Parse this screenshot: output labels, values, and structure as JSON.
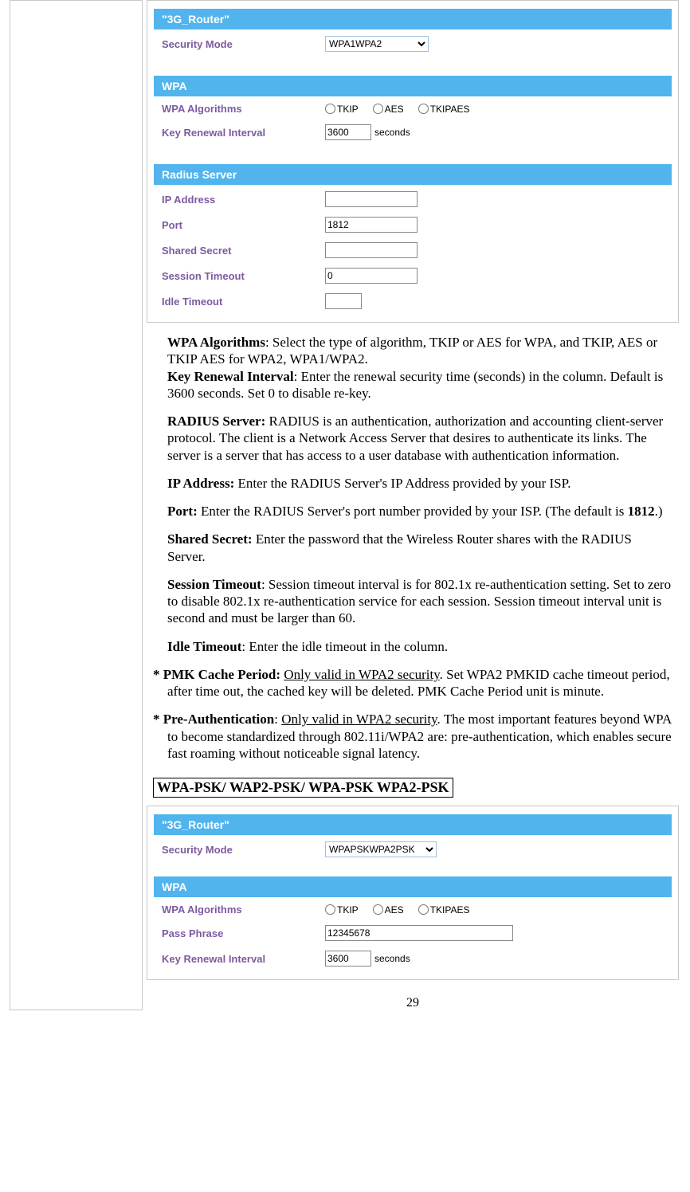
{
  "panel1": {
    "title": "\"3G_Router\"",
    "security_mode_label": "Security Mode",
    "security_mode_value": "WPA1WPA2",
    "wpa_header": "WPA",
    "wpa_algorithms_label": "WPA Algorithms",
    "algo_tkip": "TKIP",
    "algo_aes": "AES",
    "algo_tkipaes": "TKIPAES",
    "key_renewal_label": "Key Renewal Interval",
    "key_renewal_value": "3600",
    "seconds": "seconds",
    "radius_header": "Radius Server",
    "ip_label": "IP Address",
    "ip_value": "",
    "port_label": "Port",
    "port_value": "1812",
    "shared_secret_label": "Shared Secret",
    "shared_secret_value": "",
    "session_timeout_label": "Session Timeout",
    "session_timeout_value": "0",
    "idle_timeout_label": "Idle Timeout",
    "idle_timeout_value": ""
  },
  "desc": {
    "wpa_alg_bold": "WPA Algorithms",
    "wpa_alg_text": ": Select the type of algorithm, TKIP or AES for WPA, and TKIP, AES or TKIP AES for WPA2, WPA1/WPA2.",
    "key_renewal_bold": "Key Renewal Interval",
    "key_renewal_text": ": Enter the renewal security time (seconds) in the column. Default is 3600 seconds. Set 0 to disable re-key.",
    "radius_bold": "RADIUS Server:",
    "radius_text": " RADIUS is an authentication, authorization and accounting client-server protocol. The client is a Network Access Server that desires to authenticate its links. The server is a server that has access to a user database with authentication information.",
    "ip_bold": "IP Address:",
    "ip_text": " Enter the RADIUS Server's IP Address provided by your ISP.",
    "port_bold": "Port:",
    "port_text1": " Enter the RADIUS Server's port number provided by your ISP. (The default is ",
    "port_1812": "1812",
    "port_text2": ".)",
    "shared_bold": "Shared Secret:",
    "shared_text": " Enter the password that the Wireless  Router shares with the RADIUS Server.",
    "session_bold": "Session Timeout",
    "session_text": ": Session timeout interval is for 802.1x re-authentication setting. Set to zero to disable 802.1x re-authentication service for each session. Session timeout interval unit is second and must be larger than 60.",
    "idle_bold": "Idle Timeout",
    "idle_text": ": Enter the idle timeout in the column.",
    "pmk_star": "* ",
    "pmk_bold": "PMK Cache Period:",
    "pmk_under": "Only valid in WPA2 security",
    "pmk_rest": ". Set WPA2 PMKID cache timeout period, after time out, the cached key will be deleted. PMK Cache Period unit is minute.",
    "preauth_star": "* ",
    "preauth_bold": "Pre-Authentication",
    "preauth_colon": ": ",
    "preauth_under": "Only valid in WPA2 security",
    "preauth_rest": ". The most important features beyond WPA to become standardized through 802.11i/WPA2 are: pre-authentication, which enables secure fast roaming without noticeable signal latency."
  },
  "boxed_heading": "WPA-PSK/ WAP2-PSK/ WPA-PSK WPA2-PSK",
  "panel2": {
    "title": "\"3G_Router\"",
    "security_mode_label": "Security Mode",
    "security_mode_value": "WPAPSKWPA2PSK",
    "wpa_header": "WPA",
    "wpa_algorithms_label": "WPA Algorithms",
    "algo_tkip": "TKIP",
    "algo_aes": "AES",
    "algo_tkipaes": "TKIPAES",
    "pass_phrase_label": "Pass Phrase",
    "pass_phrase_value": "12345678",
    "key_renewal_label": "Key Renewal Interval",
    "key_renewal_value": "3600",
    "seconds": "seconds"
  },
  "page_number": "29"
}
